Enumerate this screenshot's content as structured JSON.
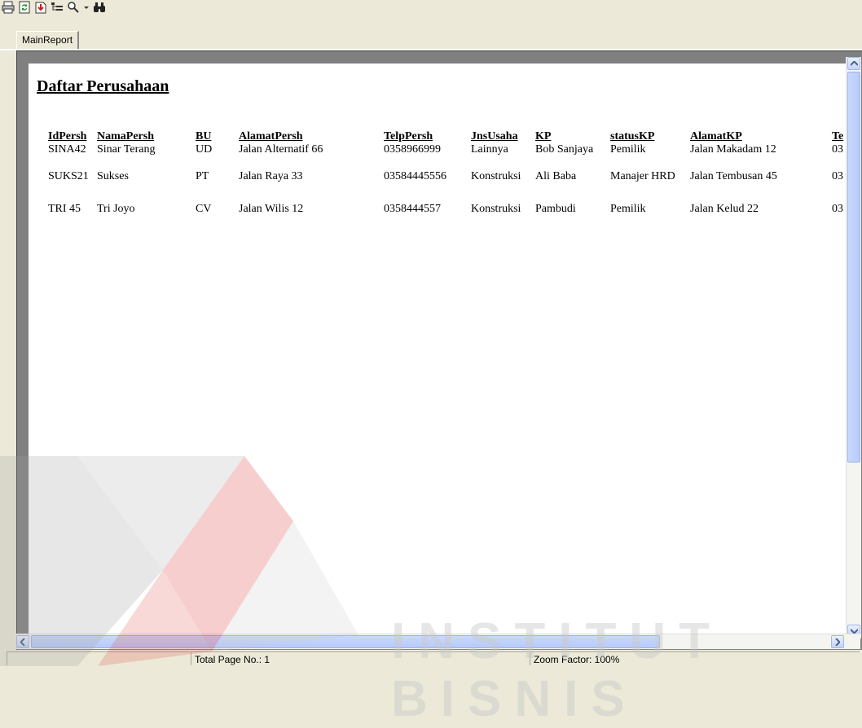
{
  "toolbar": {
    "icons": [
      "print-icon",
      "refresh-icon",
      "export-icon",
      "group-tree-icon",
      "zoom-icon",
      "zoom-dropdown-icon",
      "search-binoculars-icon"
    ]
  },
  "tabs": [
    {
      "label": "MainReport"
    }
  ],
  "report": {
    "title": "Daftar Perusahaan",
    "columns": [
      "IdPersh",
      "NamaPersh",
      "BU",
      "AlamatPersh",
      "TelpPersh",
      "JnsUsaha",
      "KP",
      "statusKP",
      "AlamatKP",
      "Te"
    ],
    "rows": [
      [
        "SINA42",
        "Sinar Terang",
        "UD",
        "Jalan Alternatif 66",
        "0358966999",
        "Lainnya",
        "Bob Sanjaya",
        "Pemilik",
        "Jalan Makadam 12",
        "03"
      ],
      [
        "SUKS21",
        "Sukses",
        "PT",
        "Jalan Raya 33",
        "03584445556",
        "Konstruksi",
        "Ali Baba",
        "Manajer HRD",
        "Jalan Tembusan 45",
        "03"
      ],
      [
        "TRI 45",
        "Tri Joyo",
        "CV",
        "Jalan Wilis 12",
        "0358444557",
        "Konstruksi",
        "Pambudi",
        "Pemilik",
        "Jalan Kelud 22",
        "03"
      ]
    ]
  },
  "status": {
    "total_page": "Total Page No.: 1",
    "zoom": "Zoom Factor: 100%"
  },
  "watermark": {
    "text": "INSTITUT BISNIS"
  },
  "colors": {
    "chrome": "#ece9d8",
    "viewer_bg": "#808080",
    "watermark_red": "#e03a3a"
  }
}
